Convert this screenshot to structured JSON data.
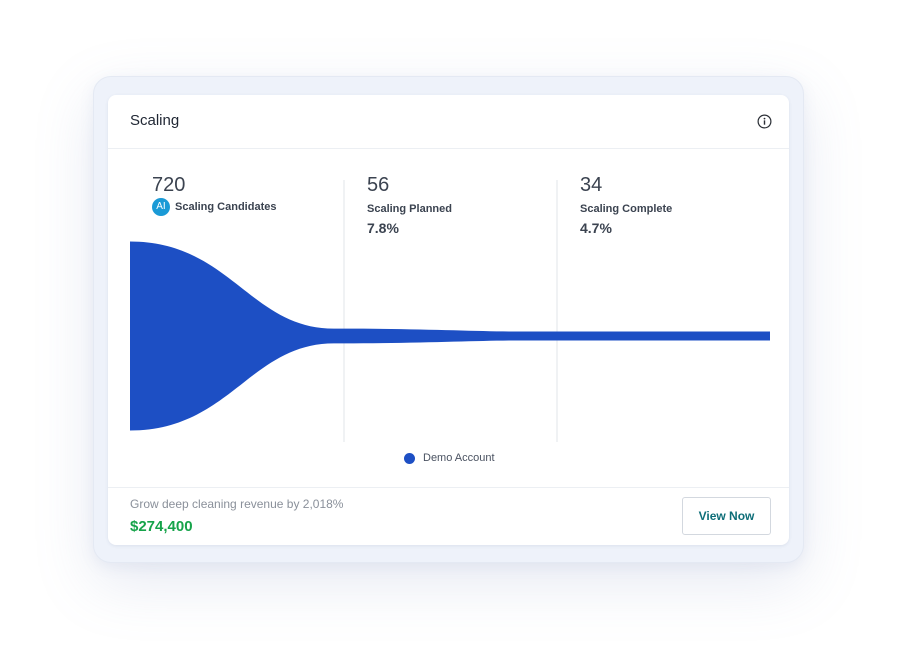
{
  "card": {
    "title": "Scaling",
    "info_icon": "info-circle-icon"
  },
  "chart_data": {
    "type": "area",
    "series": [
      {
        "name": "Demo Account",
        "color": "#1d4fc4",
        "values": [
          720,
          56,
          34
        ]
      }
    ],
    "stages": [
      {
        "count": "720",
        "label": "Scaling Candidates",
        "pct": "",
        "ai_badge": "AI"
      },
      {
        "count": "56",
        "label": "Scaling Planned",
        "pct": "7.8%"
      },
      {
        "count": "34",
        "label": "Scaling Complete",
        "pct": "4.7%"
      }
    ],
    "legend": {
      "label": "Demo Account",
      "placement": "bottom-center"
    },
    "grid": true
  },
  "footer": {
    "text": "Grow deep cleaning revenue by 2,018%",
    "value": "$274,400",
    "value_color": "#16a34a",
    "button_label": "View Now"
  }
}
